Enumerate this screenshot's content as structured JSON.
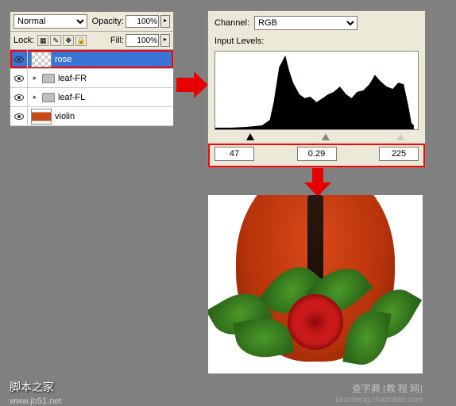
{
  "layers_panel": {
    "blend_mode": "Normal",
    "opacity_label": "Opacity:",
    "opacity_value": "100%",
    "lock_label": "Lock:",
    "fill_label": "Fill:",
    "fill_value": "100%",
    "layers": [
      {
        "name": "rose",
        "visible": true,
        "selected": true,
        "type": "layer"
      },
      {
        "name": "leaf-FR",
        "visible": true,
        "selected": false,
        "type": "group"
      },
      {
        "name": "leaf-FL",
        "visible": true,
        "selected": false,
        "type": "group"
      },
      {
        "name": "violin",
        "visible": true,
        "selected": false,
        "type": "layer"
      }
    ]
  },
  "levels_panel": {
    "channel_label": "Channel:",
    "channel_value": "RGB",
    "input_levels_label": "Input Levels:",
    "shadow": "47",
    "midtone": "0.29",
    "highlight": "225"
  },
  "chart_data": {
    "type": "area",
    "title": "",
    "xlabel": "",
    "ylabel": "",
    "x": [
      0,
      20,
      40,
      60,
      75,
      90,
      100,
      115,
      130,
      145,
      160,
      175,
      190,
      205,
      220,
      235,
      255
    ],
    "values": [
      0,
      2,
      3,
      5,
      35,
      95,
      60,
      40,
      35,
      45,
      55,
      40,
      50,
      70,
      55,
      60,
      5
    ],
    "xlim": [
      0,
      255
    ],
    "ylim": [
      0,
      100
    ]
  },
  "watermarks": {
    "w1": "脚本之家",
    "w2": "www.jb51.net",
    "w3": "查字典 [教 程 网]",
    "w4": "jiaocheng.chazidian.com"
  }
}
